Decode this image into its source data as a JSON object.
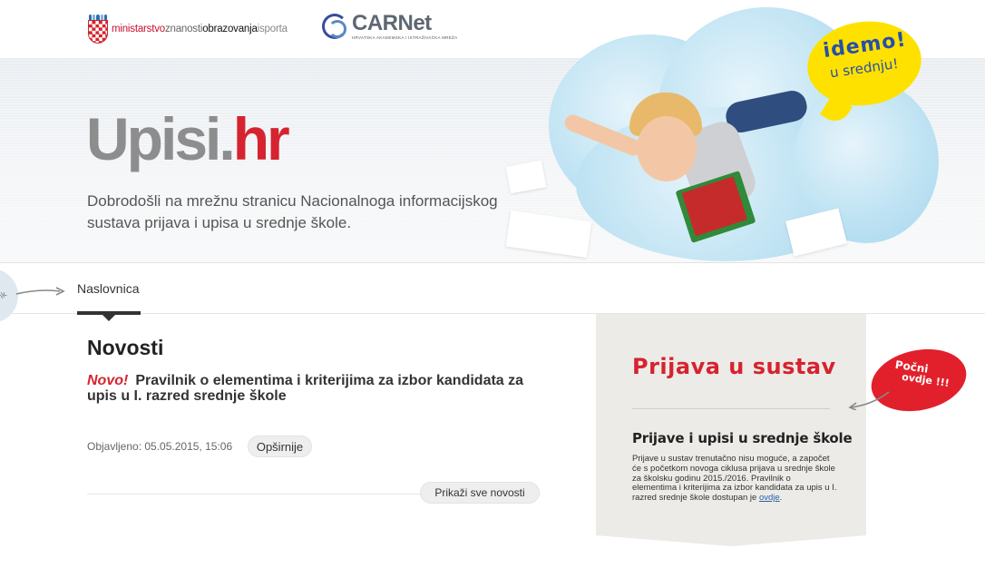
{
  "header": {
    "ministry": {
      "w1": "ministarstvo",
      "w2": "znanosti",
      "w3": "obrazovanja",
      "w4": "isporta"
    },
    "carnet": {
      "name": "CARNet",
      "sub": "HRVATSKA AKADEMSKA I ISTRAŽIVAČKA MREŽA"
    }
  },
  "hero": {
    "logo_main": "Upisi",
    "logo_dot": ".",
    "logo_tld": "hr",
    "welcome": "Dobrodošli na mrežnu stranicu Nacionalnoga informacijskog sustava prijava i upisa u srednje škole.",
    "bubble_line1": "idemo!",
    "bubble_line2": "u srednju!"
  },
  "nav": {
    "side_label": "ik",
    "items": [
      {
        "label": "Naslovnica"
      }
    ]
  },
  "news": {
    "title": "Novosti",
    "items": [
      {
        "badge": "Novo!",
        "text": "Pravilnik o elementima i kriterijima za izbor kandidata za upis u I. razred srednje škole",
        "date": "Objavljeno: 05.05.2015, 15:06",
        "more_label": "Opširnije"
      }
    ],
    "all_label": "Prikaži sve novosti"
  },
  "login": {
    "title": "Prijava u sustav",
    "subtitle": "Prijave i upisi u srednje škole",
    "text_before_link": "Prijave u sustav trenutačno nisu moguće, a započet će s početkom novoga ciklusa prijava u srednje škole za školsku godinu 2015./2016. Pravilnik o elementima i kriterijima za izbor kandidata za upis u I. razred srednje škole dostupan je ",
    "link_label": "ovdje",
    "text_after_link": ".",
    "badge_line1": "Počni",
    "badge_line2": "ovdje !!!"
  },
  "colors": {
    "accent_red": "#d62330",
    "badge_red": "#e2202b",
    "bubble_yellow": "#ffe100",
    "link_blue": "#2a5ea8"
  }
}
